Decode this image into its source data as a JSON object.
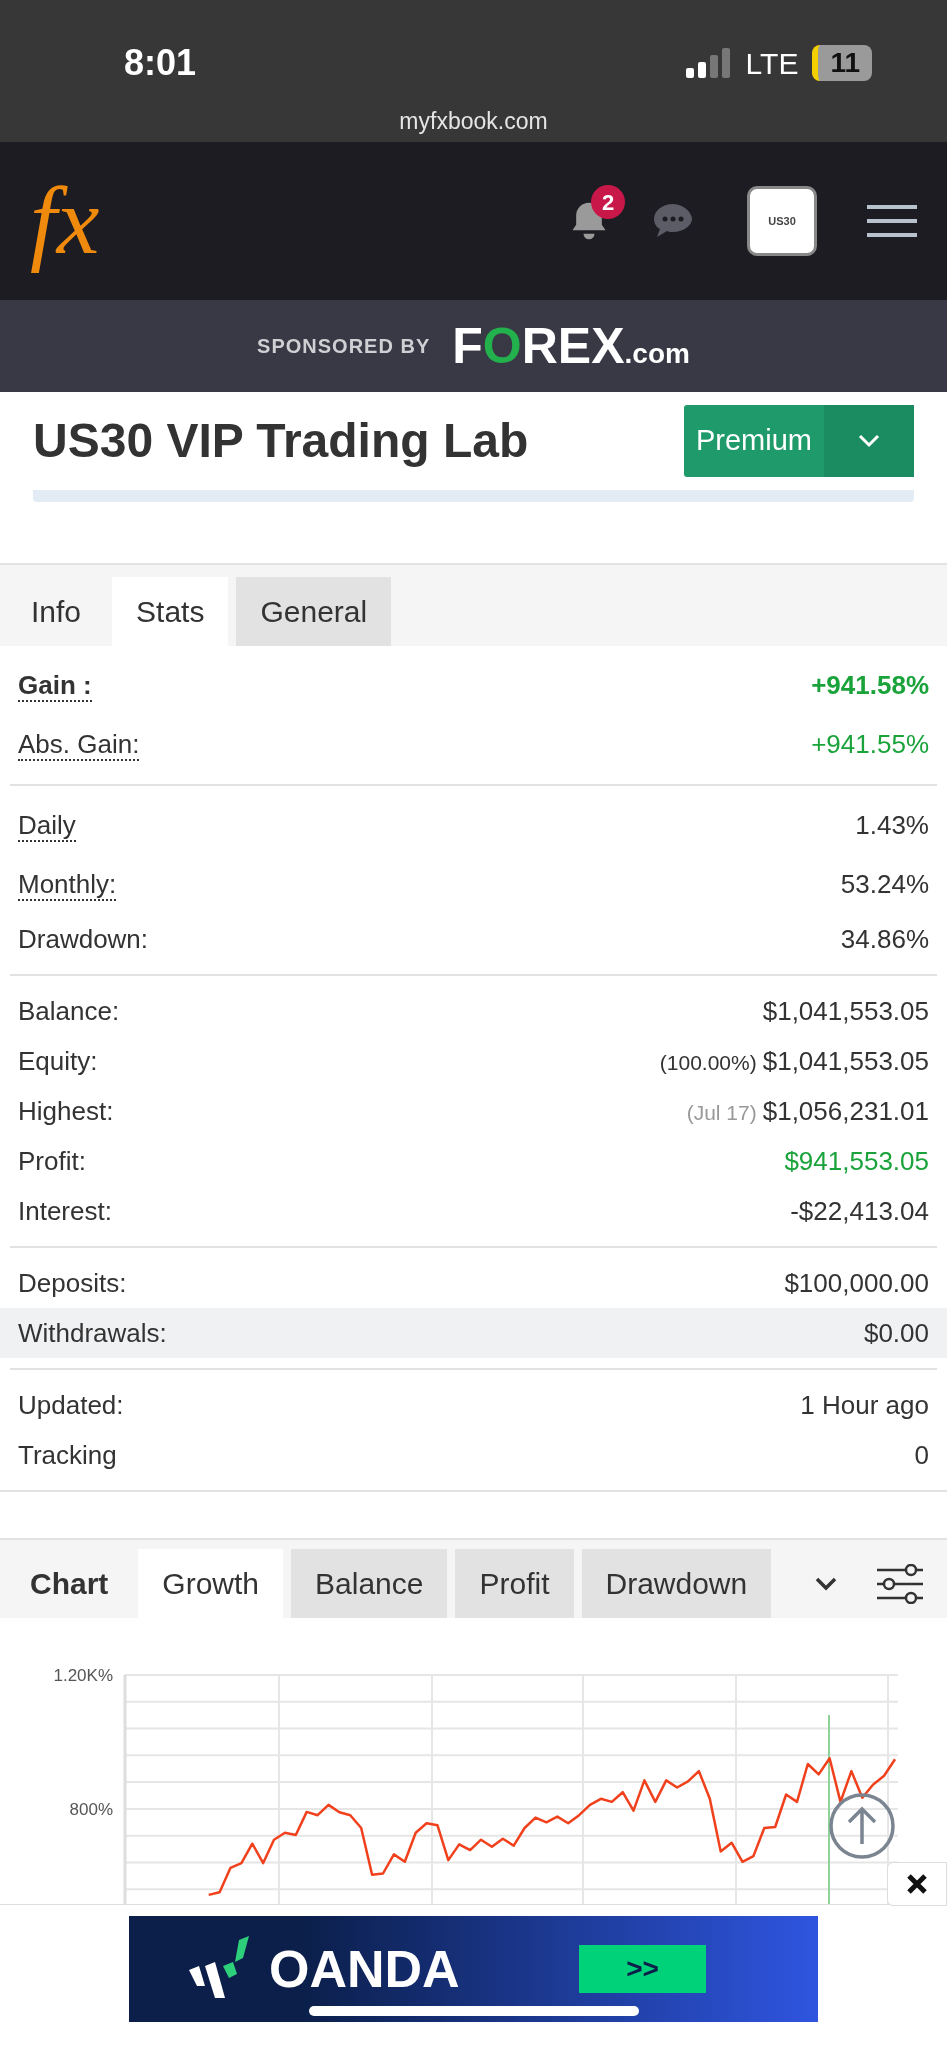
{
  "status_bar": {
    "time": "8:01",
    "network": "LTE",
    "battery": "11",
    "url": "myfxbook.com"
  },
  "nav": {
    "logo": "fx",
    "notification_count": "2",
    "avatar_text": "US30"
  },
  "sponsor": {
    "label": "SPONSORED BY",
    "brand": "FOREX",
    "brand_suffix": ".com"
  },
  "header": {
    "title": "US30 VIP Trading Lab",
    "button": "Premium"
  },
  "stats_tabs": {
    "heading": "Info",
    "tabs": [
      {
        "label": "Stats",
        "selected": true
      },
      {
        "label": "General",
        "selected": false
      }
    ]
  },
  "stats": [
    [
      {
        "label": "Gain :",
        "value": "+941.58%",
        "dotted": true,
        "bold": true,
        "positive": true,
        "highlighted": false
      },
      {
        "label": "Abs. Gain:",
        "value": "+941.55%",
        "dotted": true,
        "bold": false,
        "positive": true,
        "highlighted": false
      }
    ],
    [
      {
        "label": "Daily",
        "value": "1.43%",
        "dotted": true,
        "bold": false,
        "positive": false,
        "highlighted": false
      },
      {
        "label": "Monthly:",
        "value": "53.24%",
        "dotted": true,
        "bold": false,
        "positive": false,
        "highlighted": false
      },
      {
        "label": "Drawdown:",
        "value": "34.86%",
        "dotted": false,
        "bold": false,
        "positive": false,
        "highlighted": false
      }
    ],
    [
      {
        "label": "Balance:",
        "value": "$1,041,553.05",
        "dotted": false,
        "bold": false,
        "positive": false,
        "highlighted": false
      },
      {
        "label": "Equity:",
        "note": "(100.00%)",
        "value": "$1,041,553.05",
        "dotted": false,
        "bold": false,
        "positive": false,
        "highlighted": false
      },
      {
        "label": "Highest:",
        "note": "(Jul 17)",
        "value": "$1,056,231.01",
        "dotted": false,
        "bold": false,
        "positive": false,
        "highlighted": false
      },
      {
        "label": "Profit:",
        "value": "$941,553.05",
        "dotted": false,
        "bold": false,
        "positive": true,
        "highlighted": false
      },
      {
        "label": "Interest:",
        "value": "-$22,413.04",
        "dotted": false,
        "bold": false,
        "positive": false,
        "highlighted": false
      }
    ],
    [
      {
        "label": "Deposits:",
        "value": "$100,000.00",
        "dotted": false,
        "bold": false,
        "positive": false,
        "highlighted": false
      },
      {
        "label": "Withdrawals:",
        "value": "$0.00",
        "dotted": false,
        "bold": false,
        "positive": false,
        "highlighted": true
      }
    ],
    [
      {
        "label": "Updated:",
        "value": "1 Hour ago",
        "dotted": false,
        "bold": false,
        "positive": false,
        "highlighted": false
      },
      {
        "label": "Tracking",
        "value": "0",
        "dotted": false,
        "bold": false,
        "positive": false,
        "highlighted": false
      }
    ]
  ],
  "chart_tabs": {
    "heading": "Chart",
    "tabs": [
      {
        "label": "Growth",
        "selected": true
      },
      {
        "label": "Balance",
        "selected": false
      },
      {
        "label": "Profit",
        "selected": false
      },
      {
        "label": "Drawdown",
        "selected": false
      }
    ]
  },
  "chart": {
    "chart_data": {
      "type": "line",
      "ylim": [
        480,
        1200
      ],
      "yticks": [
        {
          "value": 800,
          "label": "800%"
        },
        {
          "value": 1200,
          "label": "1.20K%"
        }
      ],
      "series": [
        {
          "color": "#f0401c",
          "values": [
            null,
            null,
            null,
            543,
            551,
            624,
            638,
            696,
            638,
            708,
            729,
            722,
            791,
            781,
            812,
            790,
            781,
            743,
            603,
            607,
            664,
            642,
            729,
            757,
            751,
            647,
            694,
            677,
            708,
            687,
            711,
            690,
            743,
            774,
            760,
            777,
            757,
            781,
            812,
            830,
            821,
            850,
            795,
            885,
            821,
            885,
            864,
            882,
            913,
            830,
            673,
            699,
            642,
            659,
            743,
            746,
            843,
            821,
            934,
            903,
            951,
            821,
            913,
            833,
            873,
            899,
            948
          ]
        }
      ]
    }
  },
  "ad": {
    "brand": "OANDA",
    "button": ">>"
  }
}
